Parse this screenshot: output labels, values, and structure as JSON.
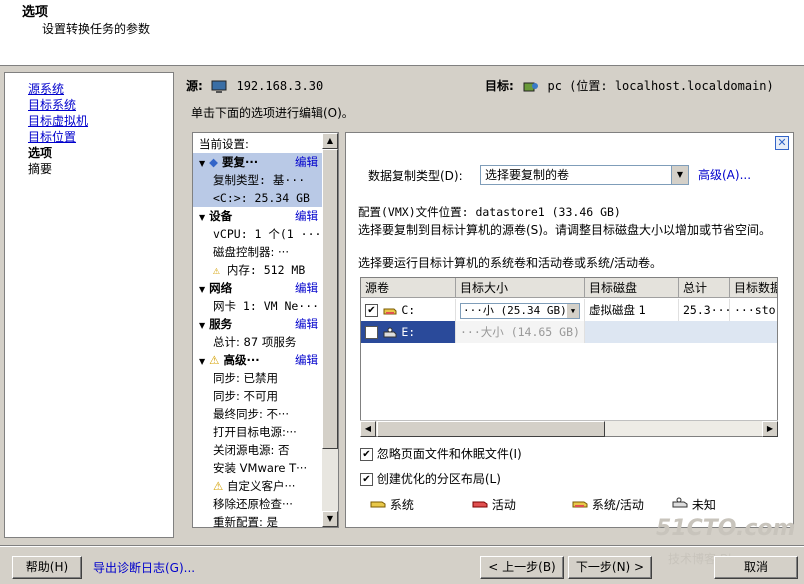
{
  "header": {
    "title": "选项",
    "subtitle": "设置转换任务的参数"
  },
  "nav": {
    "items": [
      "源系统",
      "目标系统",
      "目标虚拟机",
      "目标位置",
      "选项",
      "摘要"
    ]
  },
  "source": {
    "label": "源:",
    "value": "192.168.3.30"
  },
  "target": {
    "label": "目标:",
    "value": "pc (位置: localhost.localdomain)"
  },
  "hint": "单击下面的选项进行编辑(O)。",
  "settings": {
    "current": "当前设置:",
    "edit": "编辑",
    "sections": [
      {
        "title": "要复···",
        "rows": [
          "复制类型: 基···",
          "<C:>: 25.34 GB"
        ]
      },
      {
        "title": "设备",
        "rows": [
          "vCPU: 1 个(1 ···",
          "磁盘控制器: ···",
          "内存: 512 MB"
        ]
      },
      {
        "title": "网络",
        "rows": [
          "网卡 1: VM Ne···"
        ]
      },
      {
        "title": "服务",
        "rows": [
          "总计: 87 项服务"
        ]
      },
      {
        "title": "高级···",
        "rows": [
          "同步: 已禁用",
          "同步: 不可用",
          "最终同步: 不···",
          "打开目标电源:···",
          "关闭源电源: 否",
          "安装 VMware T···",
          "自定义客户···",
          "移除还原检查···",
          "重新配置: 是"
        ]
      }
    ]
  },
  "copy": {
    "label": "数据复制类型(D):",
    "selected": "选择要复制的卷",
    "advanced": "高级(A)..."
  },
  "vmx": "配置(VMX)文件位置: datastore1 (33.46 GB)",
  "note1": "选择要复制到目标计算机的源卷(S)。请调整目标磁盘大小以增加或节省空间。",
  "note2": "选择要运行目标计算机的系统卷和活动卷或系统/活动卷。",
  "grid": {
    "headers": [
      "源卷",
      "目标大小",
      "目标磁盘",
      "总计",
      "目标数据"
    ],
    "rows": [
      {
        "checked": "✔",
        "vol": "C:",
        "size": "···小 (25.34 GB)",
        "disk": "虚拟磁盘 1",
        "total": "25.3···",
        "data": "···store"
      },
      {
        "checked": "",
        "vol": "E:",
        "size": "···大小 (14.65 GB)",
        "disk": "",
        "total": "",
        "data": ""
      }
    ]
  },
  "options": {
    "ignore": "忽略页面文件和休眠文件(I)",
    "optimize": "创建优化的分区布局(L)"
  },
  "legend": [
    "系统",
    "活动",
    "系统/活动",
    "未知"
  ],
  "footer": {
    "help": "帮助(H)",
    "export": "导出诊断日志(G)...",
    "back": "< 上一步(B)",
    "next": "下一步(N) >",
    "cancel": "取消"
  },
  "watermark": {
    "main": "51CTO.com",
    "sub": "技术博客 Blog"
  },
  "colors": {
    "link": "#0000cc",
    "selection": "#b9c9e6",
    "system": "#e8c84a",
    "active": "#e05050"
  }
}
